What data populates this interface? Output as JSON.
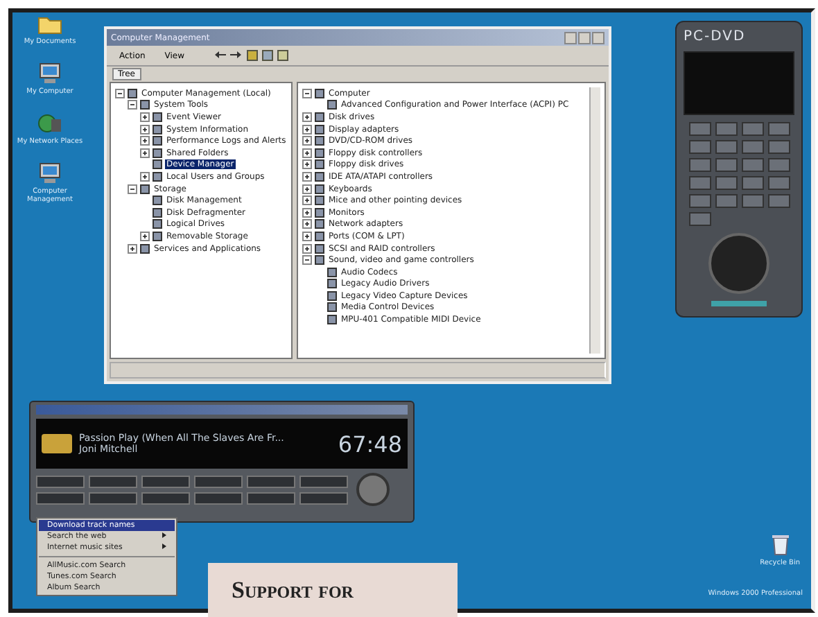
{
  "desktop_icons": [
    {
      "label": "My Documents",
      "kind": "folder"
    },
    {
      "label": "My Computer",
      "kind": "computer"
    },
    {
      "label": "My Network Places",
      "kind": "network"
    },
    {
      "label": "Computer Management",
      "kind": "computer"
    }
  ],
  "management_window": {
    "title": "Computer Management",
    "menu": [
      "Action",
      "View"
    ],
    "tab": "Tree",
    "console_tree": [
      {
        "label": "Computer Management (Local)",
        "expanded": true,
        "selected": false,
        "children": [
          {
            "label": "System Tools",
            "expanded": true,
            "selected": false,
            "children": [
              {
                "label": "Event Viewer",
                "expanded": false,
                "selected": false
              },
              {
                "label": "System Information",
                "expanded": false,
                "selected": false
              },
              {
                "label": "Performance Logs and Alerts",
                "expanded": false,
                "selected": false
              },
              {
                "label": "Shared Folders",
                "expanded": false,
                "selected": false
              },
              {
                "label": "Device Manager",
                "selected": true
              },
              {
                "label": "Local Users and Groups",
                "expanded": false,
                "selected": false
              }
            ]
          },
          {
            "label": "Storage",
            "expanded": true,
            "selected": false,
            "children": [
              {
                "label": "Disk Management",
                "selected": false
              },
              {
                "label": "Disk Defragmenter",
                "selected": false
              },
              {
                "label": "Logical Drives",
                "selected": false
              },
              {
                "label": "Removable Storage",
                "expanded": false,
                "selected": false
              }
            ]
          },
          {
            "label": "Services and Applications",
            "expanded": false,
            "selected": false
          }
        ]
      }
    ],
    "device_tree": [
      {
        "label": "Computer",
        "expanded": true,
        "children": [
          {
            "label": "Advanced Configuration and Power Interface (ACPI) PC"
          }
        ]
      },
      {
        "label": "Disk drives",
        "expanded": false
      },
      {
        "label": "Display adapters",
        "expanded": false
      },
      {
        "label": "DVD/CD-ROM drives",
        "expanded": false
      },
      {
        "label": "Floppy disk controllers",
        "expanded": false
      },
      {
        "label": "Floppy disk drives",
        "expanded": false
      },
      {
        "label": "IDE ATA/ATAPI controllers",
        "expanded": false
      },
      {
        "label": "Keyboards",
        "expanded": false
      },
      {
        "label": "Mice and other pointing devices",
        "expanded": false
      },
      {
        "label": "Monitors",
        "expanded": false
      },
      {
        "label": "Network adapters",
        "expanded": false
      },
      {
        "label": "Ports (COM & LPT)",
        "expanded": false
      },
      {
        "label": "SCSI and RAID controllers",
        "expanded": false
      },
      {
        "label": "Sound, video and game controllers",
        "expanded": true,
        "children": [
          {
            "label": "Audio Codecs"
          },
          {
            "label": "Legacy Audio Drivers"
          },
          {
            "label": "Legacy Video Capture Devices"
          },
          {
            "label": "Media Control Devices"
          },
          {
            "label": "MPU-401 Compatible MIDI Device"
          }
        ]
      }
    ]
  },
  "media_player": {
    "track": "Passion Play (When All The Slaves Are Fr...",
    "artist": "Joni Mitchell",
    "time": "67:48"
  },
  "player_menu": [
    {
      "label": "Download track names",
      "selected": true,
      "submenu": false
    },
    {
      "label": "Search the web",
      "selected": false,
      "submenu": true
    },
    {
      "label": "Internet music sites",
      "selected": false,
      "submenu": true
    },
    {
      "label": "AllMusic.com Search",
      "selected": false,
      "submenu": false
    },
    {
      "label": "Tunes.com Search",
      "selected": false,
      "submenu": false
    },
    {
      "label": "Album Search",
      "selected": false,
      "submenu": false
    }
  ],
  "dvd_remote": {
    "title": "PC-DVD"
  },
  "recycle_bin": {
    "label": "Recycle Bin"
  },
  "desktop_version": "Windows 2000 Professional",
  "caption": "Support for"
}
